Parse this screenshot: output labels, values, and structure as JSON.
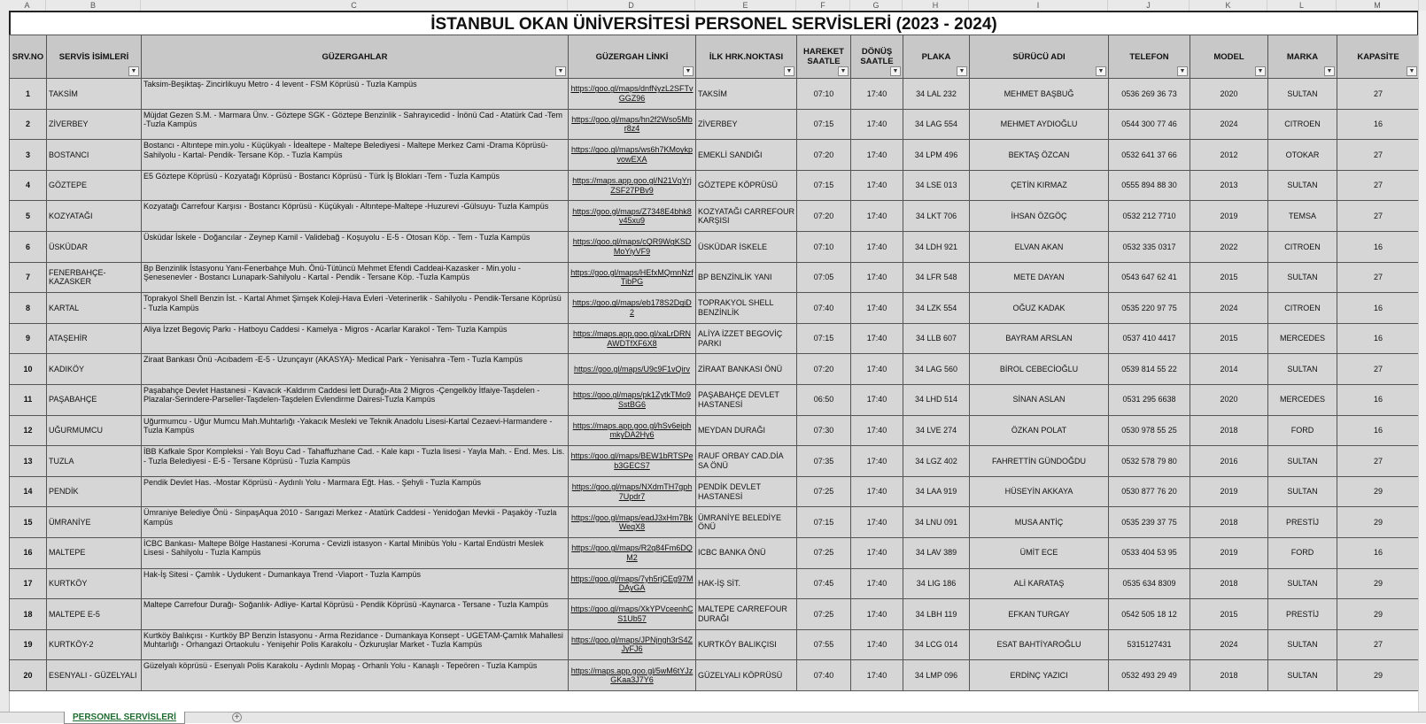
{
  "col_letters": [
    "A",
    "B",
    "C",
    "D",
    "E",
    "F",
    "G",
    "H",
    "I",
    "J",
    "K",
    "L",
    "M"
  ],
  "title": "İSTANBUL OKAN ÜNİVERSİTESİ PERSONEL SERVİSLERİ (2023 - 2024)",
  "headers": {
    "no": "SRV.NO",
    "name": "SERVİS İSİMLERİ",
    "route": "GÜZERGAHLAR",
    "link": "GÜZERGAH LİNKİ",
    "stop": "İLK HRK.NOKTASI",
    "dep": "HAREKET SAATLE",
    "ret": "DÖNÜŞ SAATLE",
    "plate": "PLAKA",
    "driver": "SÜRÜCÜ ADI",
    "phone": "TELEFON",
    "model": "MODEL",
    "brand": "MARKA",
    "cap": "KAPASİTE"
  },
  "rows": [
    {
      "no": "1",
      "name": "TAKSİM",
      "route": "Taksim-Beşiktaş- Zincirlikuyu Metro - 4 levent - FSM Köprüsü -   Tuzla Kampüs",
      "link": "https://goo.gl/maps/dnfNyzL2SFTvGGZ96",
      "stop": "TAKSİM",
      "dep": "07:10",
      "ret": "17:40",
      "plate": "34 LAL 232",
      "driver": "MEHMET BAŞBUĞ",
      "phone": "0536 269 36 73",
      "model": "2020",
      "brand": "SULTAN",
      "cap": "27"
    },
    {
      "no": "2",
      "name": "ZİVERBEY",
      "route": "Müjdat Gezen S.M. - Marmara Ünv. - Göztepe SGK - Göztepe Benzinlik - Sahrayıcedid - İnönü Cad - Atatürk Cad -Tem  -Tuzla Kampüs",
      "link": "https://goo.gl/maps/hn2f2Wso5Mbr8z4",
      "stop": "ZİVERBEY",
      "dep": "07:15",
      "ret": "17:40",
      "plate": "34 LAG 554",
      "driver": "MEHMET AYDIOĞLU",
      "phone": "0544 300 77 46",
      "model": "2024",
      "brand": "CITROEN",
      "cap": "16"
    },
    {
      "no": "3",
      "name": "BOSTANCI",
      "route": "Bostancı - Altıntepe min.yolu -  Küçükyalı - İdealtepe - Maltepe Belediyesi - Maltepe Merkez Cami -Drama Köprüsü-  Sahilyolu -  Kartal- Pendik- Tersane Köp. - Tuzla Kampüs",
      "link": "https://goo.gl/maps/ws6h7KMoykpvowEXA",
      "stop": "EMEKLİ SANDIĞI",
      "dep": "07:20",
      "ret": "17:40",
      "plate": "34 LPM 496",
      "driver": "BEKTAŞ ÖZCAN",
      "phone": "0532 641 37 66",
      "model": "2012",
      "brand": "OTOKAR",
      "cap": "27"
    },
    {
      "no": "4",
      "name": "GÖZTEPE",
      "route": "E5 Göztepe Köprüsü - Kozyatağı Köprüsü - Bostancı Köprüsü - Türk İş Blokları -Tem - Tuzla Kampüs",
      "link": "https://maps.app.goo.gl/N21VqYrjZSF27PBv9",
      "stop": "GÖZTEPE KÖPRÜSÜ",
      "dep": "07:15",
      "ret": "17:40",
      "plate": "34 LSE 013",
      "driver": "ÇETİN KIRMAZ",
      "phone": "0555 894 88 30",
      "model": "2013",
      "brand": "SULTAN",
      "cap": "27"
    },
    {
      "no": "5",
      "name": "KOZYATAĞI",
      "route": " Kozyatağı Carrefour Karşısı - Bostancı Köprüsü - Küçükyalı - Altıntepe-Maltepe -Huzurevi -Gülsuyu- Tuzla Kampüs",
      "link": "https://goo.gl/maps/Z7348E4bhk8v45xu9",
      "stop": "KOZYATAĞI CARREFOUR KARŞISI",
      "dep": "07:20",
      "ret": "17:40",
      "plate": "34 LKT 706",
      "driver": "İHSAN ÖZGÖÇ",
      "phone": "0532 212 7710",
      "model": "2019",
      "brand": "TEMSA",
      "cap": "27"
    },
    {
      "no": "6",
      "name": "ÜSKÜDAR",
      "route": "Üsküdar İskele - Doğancılar -  Zeynep Kamil - Validebağ - Koşuyolu - E-5 - Otosan Köp. - Tem - Tuzla Kampüs",
      "link": "https://goo.gl/maps/cQR9WgKSDMoYiyVF9",
      "stop": "ÜSKÜDAR İSKELE",
      "dep": "07:10",
      "ret": "17:40",
      "plate": "34 LDH 921",
      "driver": "ELVAN AKAN",
      "phone": "0532 335 0317",
      "model": "2022",
      "brand": "CITROEN",
      "cap": "16"
    },
    {
      "no": "7",
      "name": "FENERBAHÇE-KAZASKER",
      "route": "Bp Benzinlik İstasyonu Yanı-Fenerbahçe Muh. Önü-Tütüncü Mehmet Efendi Caddeai-Kazasker - Min.yolu - Şenesenevler - Bostancı Lunapark-Sahilyolu - Kartal - Pendik - Tersane Köp. -Tuzla Kampüs",
      "link": "https://goo.gl/maps/HEfxMQmnNzfTibPG",
      "stop": "BP BENZİNLİK YANI",
      "dep": "07:05",
      "ret": "17:40",
      "plate": "34 LFR 548",
      "driver": "METE DAYAN",
      "phone": "0543 647 62 41",
      "model": "2015",
      "brand": "SULTAN",
      "cap": "27"
    },
    {
      "no": "8",
      "name": "KARTAL",
      "route": "Toprakyol Shell Benzin İst. -  Kartal Ahmet Şimşek Koleji-Hava Evleri -Veterinerlik -  Sahilyolu - Pendik-Tersane Köprüsü - Tuzla Kampüs",
      "link": "https://goo.gl/maps/eb178S2DqiD2",
      "stop": "TOPRAKYOL SHELL BENZİNLİK",
      "dep": "07:40",
      "ret": "17:40",
      "plate": "34 LZK 554",
      "driver": "OĞUZ KADAK",
      "phone": "0535 220 97 75",
      "model": "2024",
      "brand": "CITROEN",
      "cap": "16"
    },
    {
      "no": "9",
      "name": "ATAŞEHİR",
      "route": "Aliya İzzet Begoviç Parkı - Hatboyu Caddesi - Kamelya - Migros - Acarlar Karakol - Tem- Tuzla Kampüs",
      "link": "https://maps.app.goo.gl/xaLrDRNAWDTfXF6X8",
      "stop": "ALİYA İZZET BEGOVİÇ PARKI",
      "dep": "07:15",
      "ret": "17:40",
      "plate": "34 LLB 607",
      "driver": "BAYRAM ARSLAN",
      "phone": "0537 410 4417",
      "model": "2015",
      "brand": "MERCEDES",
      "cap": "16"
    },
    {
      "no": "10",
      "name": "KADIKÖY",
      "route": " Ziraat Bankası Önü -Acıbadem -E-5 - Uzunçayır (AKASYA)- Medical Park -  Yenisahra -Tem - Tuzla Kampüs",
      "link": "https://goo.gl/maps/U9c9F1vQirv",
      "stop": "ZİRAAT BANKASI ÖNÜ",
      "dep": "07:20",
      "ret": "17:40",
      "plate": "34 LAG 560",
      "driver": "BİROL CEBECİOĞLU",
      "phone": "0539 814 55 22",
      "model": "2014",
      "brand": "SULTAN",
      "cap": "27"
    },
    {
      "no": "11",
      "name": "PAŞABAHÇE",
      "route": "Paşabahçe Devlet Hastanesi - Kavacık  -Kaldırım Caddesi İett Durağı-Ata 2 Migros -Çengelköy İtfaiye-Taşdelen -Plazalar-Serindere-Parseller-Taşdelen-Taşdelen Evlendirme Dairesi-Tuzla Kampüs",
      "link": "https://goo.gl/maps/pk1ZytkTMo9SstBG6",
      "stop": "PAŞABAHÇE DEVLET HASTANESİ",
      "dep": "06:50",
      "ret": "17:40",
      "plate": "34 LHD 514",
      "driver": "SİNAN ASLAN",
      "phone": "0531 295 6638",
      "model": "2020",
      "brand": "MERCEDES",
      "cap": "16"
    },
    {
      "no": "12",
      "name": "UĞURMUMCU",
      "route": "Uğurmumcu - Uğur Mumcu Mah.Muhtarlığı -Yakacık Mesleki ve Teknik Anadolu Lisesi-Kartal Cezaevi-Harmandere - Tuzla Kampüs",
      "link": "https://maps.app.goo.gl/hSv6eiphmkyDA2Hy6",
      "stop": "MEYDAN DURAĞI",
      "dep": "07:30",
      "ret": "17:40",
      "plate": "34 LVE 274",
      "driver": "ÖZKAN POLAT",
      "phone": "0530 978 55 25",
      "model": "2018",
      "brand": "FORD",
      "cap": "16"
    },
    {
      "no": "13",
      "name": "TUZLA",
      "route": "İBB Kafkale Spor Kompleksi - Yalı Boyu Cad  -  Tahaffuzhane Cad. - Kale kapı - Tuzla lisesi - Yayla Mah. - End. Mes. Lis. - Tuzla Belediyesi - E-5  - Tersane Köprüsü  - Tuzla Kampüs",
      "link": "https://goo.gl/maps/BEW1bRTSPeb3GECS7",
      "stop": "RAUF ORBAY CAD.DİA SA ÖNÜ",
      "dep": "07:35",
      "ret": "17:40",
      "plate": "34 LGZ 402",
      "driver": "FAHRETTİN GÜNDOĞDU",
      "phone": "0532 578 79 80",
      "model": "2016",
      "brand": "SULTAN",
      "cap": "27"
    },
    {
      "no": "14",
      "name": "PENDİK",
      "route": "Pendik Devlet Has. -Mostar Köprüsü - Aydınlı Yolu - Marmara Eğt. Has. -  Şehyli - Tuzla Kampüs",
      "link": "https://goo.gl/maps/NXdmTH7gph7Updr7",
      "stop": "PENDİK DEVLET HASTANESİ",
      "dep": "07:25",
      "ret": "17:40",
      "plate": "34 LAA 919",
      "driver": "HÜSEYİN AKKAYA",
      "phone": "0530 877 76 20",
      "model": "2019",
      "brand": "SULTAN",
      "cap": "29"
    },
    {
      "no": "15",
      "name": "ÜMRANİYE",
      "route": "Ümraniye Belediye Önü - SinpaşAqua 2010 -  Sarıgazi Merkez - Atatürk Caddesi - Yenidoğan Mevkii - Paşaköy -Tuzla Kampüs",
      "link": "https://goo.gl/maps/eadJ3xHm7BkWeqX8",
      "stop": "ÜMRANİYE BELEDİYE ÖNÜ",
      "dep": "07:15",
      "ret": "17:40",
      "plate": "34 LNU 091",
      "driver": "MUSA ANTİÇ",
      "phone": "0535 239 37 75",
      "model": "2018",
      "brand": "PRESTİJ",
      "cap": "29"
    },
    {
      "no": "16",
      "name": "MALTEPE",
      "route": "İCBC Bankası-  Maltepe Bölge Hastanesi -Koruma - Cevizli istasyon - Kartal Minibüs Yolu - Kartal Endüstri Meslek Lisesi -  Sahilyolu - Tuzla Kampüs",
      "link": "https://goo.gl/maps/R2q84Fm6DQM2",
      "stop": "ICBC BANKA ÖNÜ",
      "dep": "07:25",
      "ret": "17:40",
      "plate": "34 LAV 389",
      "driver": "ÜMİT ECE",
      "phone": "0533 404 53 95",
      "model": "2019",
      "brand": "FORD",
      "cap": "16"
    },
    {
      "no": "17",
      "name": "KURTKÖY",
      "route": " Hak-İş Sitesi -  Çamlık  - Uydukent - Dumankaya Trend -Viaport - Tuzla Kampüs",
      "link": "https://goo.gl/maps/7yh5rjCEg97MDAyGA",
      "stop": "HAK-İŞ SİT.",
      "dep": "07:45",
      "ret": "17:40",
      "plate": "34 LIG 186",
      "driver": "ALİ KARATAŞ",
      "phone": "0535 634 8309",
      "model": "2018",
      "brand": "SULTAN",
      "cap": "29"
    },
    {
      "no": "18",
      "name": "MALTEPE E-5",
      "route": " Maltepe Carrefour Durağı- Soğanlık- Adliye- Kartal Köprüsü - Pendik Köprüsü -Kaynarca - Tersane - Tuzla Kampüs",
      "link": "https://goo.gl/maps/XkYPVceenhCS1Ub57",
      "stop": "MALTEPE CARREFOUR DURAĞI",
      "dep": "07:25",
      "ret": "17:40",
      "plate": "34 LBH 119",
      "driver": "EFKAN TURGAY",
      "phone": "0542 505 18 12",
      "model": "2015",
      "brand": "PRESTİJ",
      "cap": "29"
    },
    {
      "no": "19",
      "name": "KURTKÖY-2",
      "route": "Kurtköy Balıkçısı - Kurtköy BP Benzin İstasyonu -  Arma Rezidance - Dumankaya Konsept - UGETAM-Çamlık Mahallesi Muhtarlığı - Orhangazi Ortaokulu - Yenişehir Polis Karakolu - Özkuruşlar Market - Tuzla Kampüs",
      "link": "https://goo.gl/maps/JPNjngh3rS4ZJyFJ6",
      "stop": "KURTKÖY BALIKÇISI",
      "dep": "07:55",
      "ret": "17:40",
      "plate": "34 LCG 014",
      "driver": "ESAT BAHTİYAROĞLU",
      "phone": "5315127431",
      "model": "2024",
      "brand": "SULTAN",
      "cap": "27"
    },
    {
      "no": "20",
      "name": "ESENYALI - GÜZELYALI",
      "route": "Güzelyalı köprüsü - Esenyalı Polis Karakolu - Aydınlı Mopaş - Orhanlı Yolu - Kanaşlı - Tepeören -   Tuzla Kampüs",
      "link": "https://maps.app.goo.gl/5wM6tYJzGKaa3J7Y6",
      "stop": "GÜZELYALI KÖPRÜSÜ",
      "dep": "07:40",
      "ret": "17:40",
      "plate": "34 LMP 096",
      "driver": "ERDİNÇ YAZICI",
      "phone": "0532 493 29 49",
      "model": "2018",
      "brand": "SULTAN",
      "cap": "29"
    }
  ],
  "sheet_tab": "PERSONEL SERVİSLERİ",
  "add_sheet_label": "+"
}
